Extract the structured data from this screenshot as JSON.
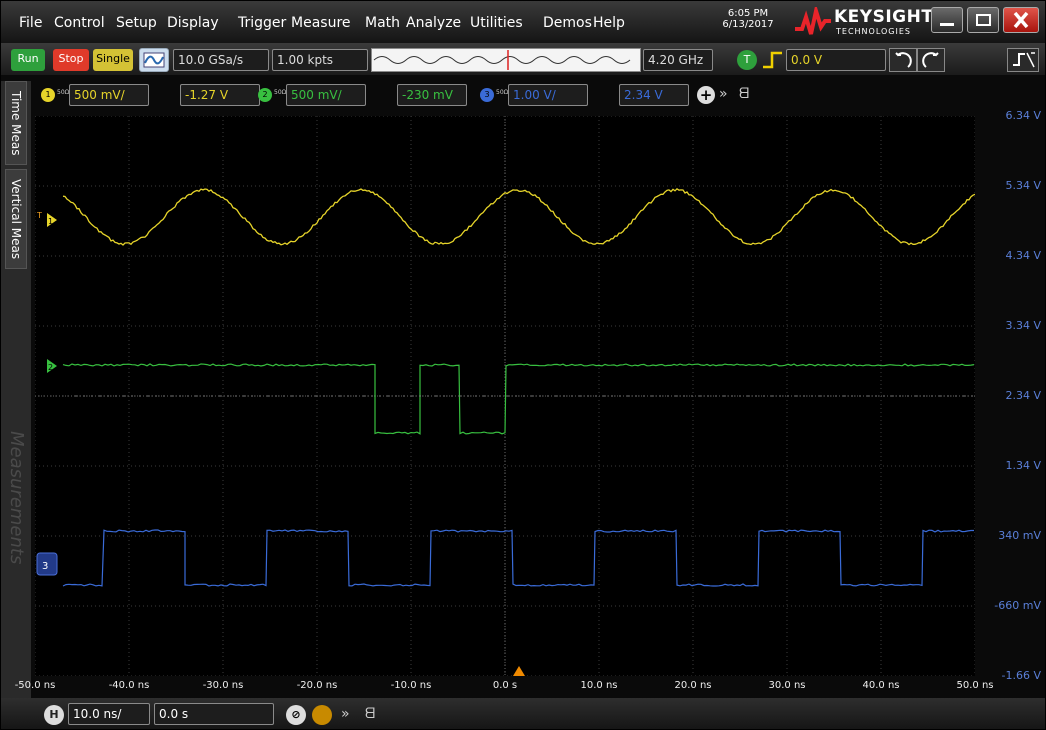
{
  "menu": [
    "File",
    "Control",
    "Setup",
    "Display",
    "Trigger",
    "Measure",
    "Math",
    "Analyze",
    "Utilities",
    "Demos",
    "Help"
  ],
  "clock": {
    "time": "6:05 PM",
    "date": "6/13/2017"
  },
  "brand": {
    "name": "KEYSIGHT",
    "sub": "TECHNOLOGIES"
  },
  "toolbar": {
    "run": "Run",
    "stop": "Stop",
    "single": "Single",
    "sample_rate": "10.0 GSa/s",
    "memory": "1.00 kpts",
    "bandwidth": "4.20 GHz",
    "trigger_badge": "T",
    "trigger_level": "0.0 V"
  },
  "channels": [
    {
      "num": "1",
      "ohm": "50Ω",
      "scale": "500 mV/",
      "offset": "-1.27 V",
      "color": "#e6d42a"
    },
    {
      "num": "2",
      "ohm": "50Ω",
      "scale": "500 mV/",
      "offset": "-230 mV",
      "color": "#38c040"
    },
    {
      "num": "3",
      "ohm": "50Ω",
      "scale": "1.00 V/",
      "offset": "2.34 V",
      "color": "#3a6bd8"
    }
  ],
  "side_tabs": {
    "time": "Time Meas",
    "vertical": "Vertical Meas",
    "measurements": "Measurements"
  },
  "markers": {
    "ch1": "1",
    "ch2": "2",
    "ch3": "3",
    "trigger": "T"
  },
  "volt_labels": [
    "6.34 V",
    "5.34 V",
    "4.34 V",
    "3.34 V",
    "2.34 V",
    "1.34 V",
    "340 mV",
    "-660 mV",
    "-1.66 V"
  ],
  "time_labels": [
    "-50.0 ns",
    "-40.0 ns",
    "-30.0 ns",
    "-20.0 ns",
    "-10.0 ns",
    "0.0 s",
    "10.0 ns",
    "20.0 ns",
    "30.0 ns",
    "40.0 ns",
    "50.0 ns"
  ],
  "timebase": {
    "badge": "H",
    "scale": "10.0 ns/",
    "position": "0.0 s"
  },
  "colors": {
    "ch1": "#e6d42a",
    "ch2": "#38c040",
    "ch3": "#3a6bd8",
    "trigger": "#f08a00",
    "grid": "#3c3c3c",
    "volt_label": "#5a7fd8"
  }
}
